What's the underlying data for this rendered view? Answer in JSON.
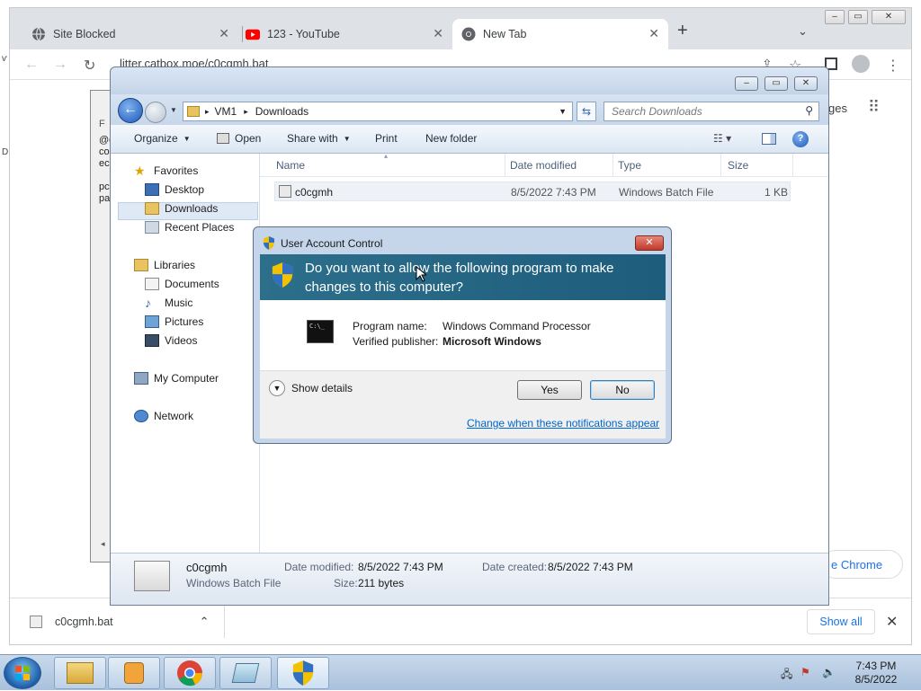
{
  "browser": {
    "tabs": [
      {
        "title": "Site Blocked",
        "icon": "globe-icon"
      },
      {
        "title": "123 - YouTube",
        "icon": "youtube-icon"
      },
      {
        "title": "New Tab",
        "icon": "chrome-icon",
        "active": true
      }
    ],
    "omnibox_url": "litter.catbox.moe/c0cgmh.bat",
    "partial_right_text": "ges",
    "chrome_button": "e Chrome",
    "download": {
      "file": "c0cgmh.bat",
      "show_all": "Show all"
    }
  },
  "notepad_fragment": [
    "@e",
    "co",
    "ec",
    "",
    "pc",
    "pa",
    "F"
  ],
  "explorer": {
    "breadcrumb": [
      "VM1",
      "Downloads"
    ],
    "search_placeholder": "Search Downloads",
    "commands": [
      "Organize",
      "Open",
      "Share with",
      "Print",
      "New folder"
    ],
    "nav": {
      "favorites": {
        "label": "Favorites",
        "items": [
          "Desktop",
          "Downloads",
          "Recent Places"
        ]
      },
      "libraries": {
        "label": "Libraries",
        "items": [
          "Documents",
          "Music",
          "Pictures",
          "Videos"
        ]
      },
      "computer": "My Computer",
      "network": "Network"
    },
    "columns": [
      "Name",
      "Date modified",
      "Type",
      "Size"
    ],
    "files": [
      {
        "name": "c0cgmh",
        "modified": "8/5/2022 7:43 PM",
        "type": "Windows Batch File",
        "size": "1 KB"
      }
    ],
    "details": {
      "name": "c0cgmh",
      "type": "Windows Batch File",
      "modified_label": "Date modified:",
      "modified": "8/5/2022 7:43 PM",
      "created_label": "Date created:",
      "created": "8/5/2022 7:43 PM",
      "size_label": "Size:",
      "size": "211 bytes"
    }
  },
  "uac": {
    "title": "User Account Control",
    "question": "Do you want to allow the following program to make changes to this computer?",
    "program_label": "Program name:",
    "program": "Windows Command Processor",
    "publisher_label": "Verified publisher:",
    "publisher": "Microsoft Windows",
    "show_details": "Show details",
    "yes": "Yes",
    "no": "No",
    "link": "Change when these notifications appear"
  },
  "taskbar": {
    "time": "7:43 PM",
    "date": "8/5/2022",
    "pinned": [
      "explorer-icon",
      "media-player-icon",
      "chrome-icon",
      "notepad-icon",
      "uac-shield-icon"
    ]
  }
}
